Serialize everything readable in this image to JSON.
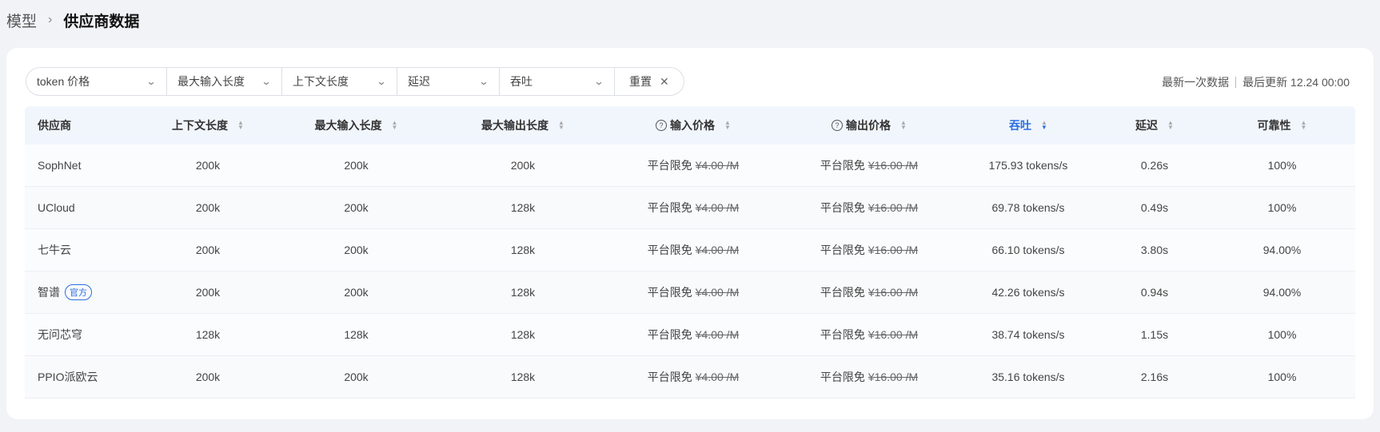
{
  "breadcrumb": {
    "root": "模型",
    "separator": "›",
    "current": "供应商数据"
  },
  "filters": [
    {
      "label": "token 价格",
      "width": 176
    },
    {
      "label": "最大输入长度",
      "width": 144
    },
    {
      "label": "上下文长度",
      "width": 144
    },
    {
      "label": "延迟",
      "width": 128
    },
    {
      "label": "吞吐",
      "width": 144
    }
  ],
  "reset_label": "重置",
  "update": {
    "latest": "最新一次数据",
    "last_updated": "最后更新 12.24 00:00"
  },
  "columns": [
    {
      "label": "供应商",
      "sortable": false
    },
    {
      "label": "上下文长度",
      "sortable": true
    },
    {
      "label": "最大输入长度",
      "sortable": true
    },
    {
      "label": "最大输出长度",
      "sortable": true
    },
    {
      "label": "输入价格",
      "sortable": true,
      "help": true
    },
    {
      "label": "输出价格",
      "sortable": true,
      "help": true
    },
    {
      "label": "吞吐",
      "sortable": true,
      "active": true,
      "direction": "desc"
    },
    {
      "label": "延迟",
      "sortable": true
    },
    {
      "label": "可靠性",
      "sortable": true
    }
  ],
  "free_label": "平台限免",
  "rows": [
    {
      "provider": "SophNet",
      "badge": "",
      "context": "200k",
      "max_input": "200k",
      "max_output": "200k",
      "input_price": "¥4.00 /M",
      "output_price": "¥16.00 /M",
      "throughput": "175.93 tokens/s",
      "latency": "0.26s",
      "reliability": "100%"
    },
    {
      "provider": "UCloud",
      "badge": "",
      "context": "200k",
      "max_input": "200k",
      "max_output": "128k",
      "input_price": "¥4.00 /M",
      "output_price": "¥16.00 /M",
      "throughput": "69.78 tokens/s",
      "latency": "0.49s",
      "reliability": "100%"
    },
    {
      "provider": "七牛云",
      "badge": "",
      "context": "200k",
      "max_input": "200k",
      "max_output": "128k",
      "input_price": "¥4.00 /M",
      "output_price": "¥16.00 /M",
      "throughput": "66.10 tokens/s",
      "latency": "3.80s",
      "reliability": "94.00%"
    },
    {
      "provider": "智谱",
      "badge": "官方",
      "context": "200k",
      "max_input": "200k",
      "max_output": "128k",
      "input_price": "¥4.00 /M",
      "output_price": "¥16.00 /M",
      "throughput": "42.26 tokens/s",
      "latency": "0.94s",
      "reliability": "94.00%"
    },
    {
      "provider": "无问芯穹",
      "badge": "",
      "context": "128k",
      "max_input": "128k",
      "max_output": "128k",
      "input_price": "¥4.00 /M",
      "output_price": "¥16.00 /M",
      "throughput": "38.74 tokens/s",
      "latency": "1.15s",
      "reliability": "100%"
    },
    {
      "provider": "PPIO派欧云",
      "badge": "",
      "context": "200k",
      "max_input": "200k",
      "max_output": "128k",
      "input_price": "¥4.00 /M",
      "output_price": "¥16.00 /M",
      "throughput": "35.16 tokens/s",
      "latency": "2.16s",
      "reliability": "100%"
    }
  ]
}
